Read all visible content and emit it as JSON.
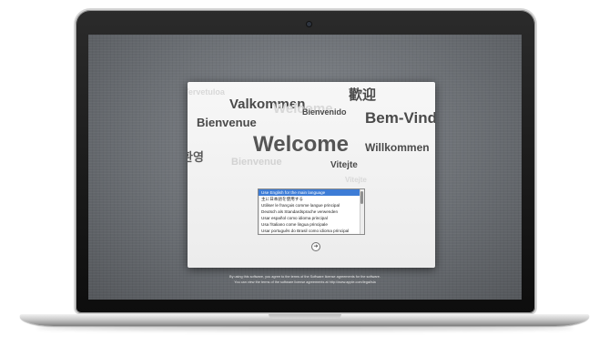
{
  "welcome_words": [
    {
      "text": "Tervetuloa",
      "color": "#d8d8d8",
      "size": 9
    },
    {
      "text": "Valkommen",
      "color": "#4a4a4a",
      "size": 15
    },
    {
      "text": "歡迎",
      "color": "#4a4a4a",
      "size": 15
    },
    {
      "text": "Welcome",
      "color": "#d8d8d8",
      "size": 15
    },
    {
      "text": "Bienvenido",
      "color": "#4a4a4a",
      "size": 9
    },
    {
      "text": "Bienvenue",
      "color": "#4a4a4a",
      "size": 13
    },
    {
      "text": "Bem-Vindo",
      "color": "#4a4a4a",
      "size": 17
    },
    {
      "text": "Welcome",
      "color": "#555555",
      "size": 24
    },
    {
      "text": "환영",
      "color": "#5a5a5a",
      "size": 13
    },
    {
      "text": "Willkommen",
      "color": "#4a4a4a",
      "size": 12
    },
    {
      "text": "Bienvenue",
      "color": "#d2d2d2",
      "size": 11
    },
    {
      "text": "Vitejte",
      "color": "#4a4a4a",
      "size": 10
    },
    {
      "text": "Vitejte",
      "color": "#d8d8d8",
      "size": 8
    }
  ],
  "language_list": [
    "Use English for the main language",
    "主に日本語を使用する",
    "Utiliser le français comme langue principal",
    "Deutsch als Standardsprache verwenden",
    "Usar español como idioma principal",
    "Usa l'italiano come lingua principale",
    "Usar português do Brasil como idioma principal"
  ],
  "selected_language_index": 0,
  "next_button_symbol": "➜",
  "legal_text_1": "By using this software, you agree to the terms of the Software license agreements for the software.",
  "legal_text_2": "You can view the terms of the software license agreements at http://www.apple.com/legal/sla"
}
